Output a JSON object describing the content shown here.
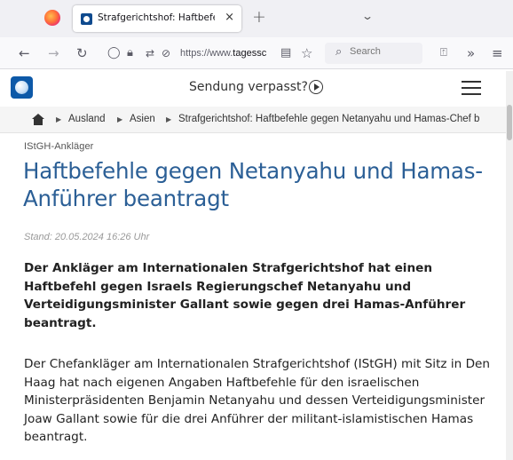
{
  "browser": {
    "tab": {
      "title": "Strafgerichtshof: Haftbefehle gegen Netanyahu",
      "close_glyph": "×"
    },
    "new_tab_glyph": "+",
    "list_all_tabs_glyph": "⌄",
    "url": {
      "prefix": "https://www.",
      "host": "tagessc"
    },
    "search": {
      "placeholder": "Search"
    }
  },
  "site": {
    "header": {
      "sendung_label": "Sendung verpasst?"
    },
    "breadcrumb": {
      "items": [
        "Ausland",
        "Asien",
        "Strafgerichtshof: Haftbefehle gegen Netanyahu und Hamas-Chef b"
      ]
    }
  },
  "article": {
    "kicker": "IStGH-Ankläger",
    "headline": "Haftbefehle gegen Netanyahu und Hamas-Anführer beantragt",
    "stand": "Stand: 20.05.2024 16:26 Uhr",
    "lead": "Der Ankläger am Internationalen Strafgerichtshof hat einen Haftbefehl gegen Israels Regierungschef Netanyahu und Verteidigungsminister Gallant sowie gegen drei Hamas-Anführer beantragt.",
    "paragraph": "Der Chefankläger am Internationalen Strafgerichtshof (IStGH) mit Sitz in Den Haag hat nach eigenen Angaben Haftbefehle für den israelischen Ministerpräsidenten Benjamin Netanyahu und dessen Verteidigungsminister Joaw Gallant sowie für die drei Anführer der militant-islamistischen Hamas beantragt."
  },
  "colors": {
    "headline": "#2b5f96",
    "logo": "#0d59a8",
    "tab_strip": "#f0f0f4"
  }
}
